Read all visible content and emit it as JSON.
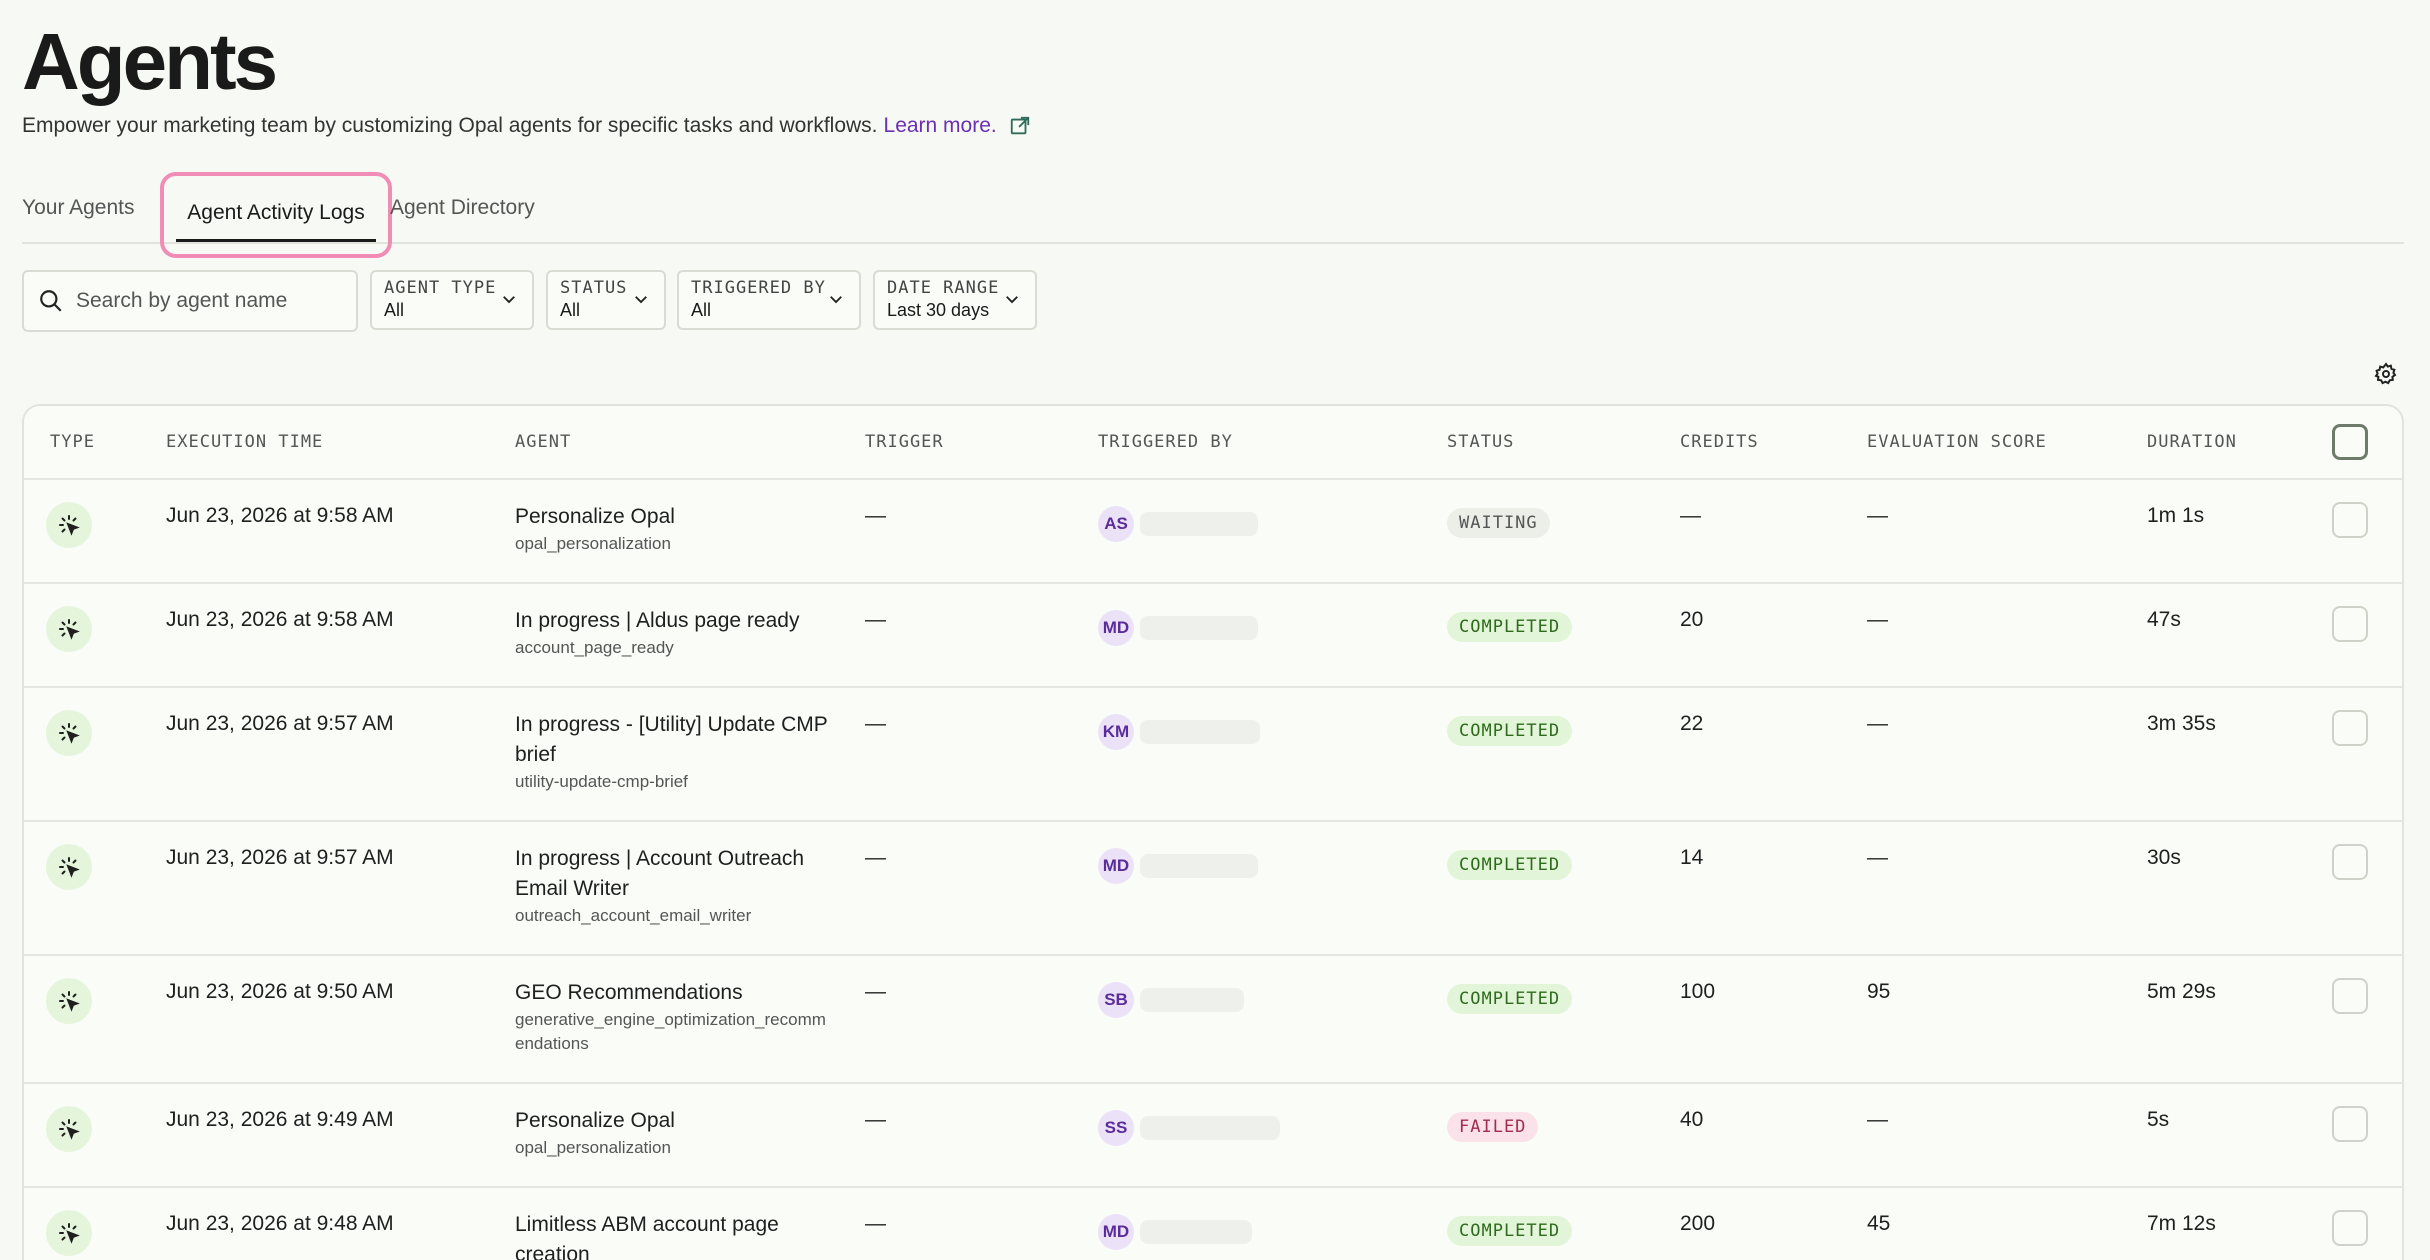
{
  "page": {
    "title": "Agents",
    "subtitle": "Empower your marketing team by customizing Opal agents for specific tasks and workflows.",
    "learn_more": "Learn more."
  },
  "tabs": [
    {
      "label": "Your Agents",
      "active": false
    },
    {
      "label": "Agent Activity Logs",
      "active": true
    },
    {
      "label": "Agent Directory",
      "active": false
    }
  ],
  "search": {
    "placeholder": "Search by agent name"
  },
  "filters": {
    "agent_type": {
      "label": "AGENT TYPE",
      "value": "All"
    },
    "status": {
      "label": "STATUS",
      "value": "All"
    },
    "triggered_by": {
      "label": "TRIGGERED BY",
      "value": "All"
    },
    "date_range": {
      "label": "DATE RANGE",
      "value": "Last 30 days"
    }
  },
  "table": {
    "headers": {
      "type": "TYPE",
      "execution_time": "EXECUTION TIME",
      "agent": "AGENT",
      "trigger": "TRIGGER",
      "triggered_by": "TRIGGERED BY",
      "status": "STATUS",
      "credits": "CREDITS",
      "evaluation_score": "EVALUATION SCORE",
      "duration": "DURATION"
    },
    "rows": [
      {
        "time": "Jun 23, 2026 at 9:58 AM",
        "agent": "Personalize Opal",
        "slug": "opal_personalization",
        "trigger": "—",
        "initials": "AS",
        "status": "WAITING",
        "credits": "—",
        "score": "—",
        "duration": "1m 1s"
      },
      {
        "time": "Jun 23, 2026 at 9:58 AM",
        "agent": "In progress | Aldus page ready",
        "slug": "account_page_ready",
        "trigger": "—",
        "initials": "MD",
        "status": "COMPLETED",
        "credits": "20",
        "score": "—",
        "duration": "47s"
      },
      {
        "time": "Jun 23, 2026 at 9:57 AM",
        "agent": "In progress - [Utility] Update CMP brief",
        "slug": "utility-update-cmp-brief",
        "trigger": "—",
        "initials": "KM",
        "status": "COMPLETED",
        "credits": "22",
        "score": "—",
        "duration": "3m 35s"
      },
      {
        "time": "Jun 23, 2026 at 9:57 AM",
        "agent": "In progress | Account Outreach Email Writer",
        "slug": "outreach_account_email_writer",
        "trigger": "—",
        "initials": "MD",
        "status": "COMPLETED",
        "credits": "14",
        "score": "—",
        "duration": "30s"
      },
      {
        "time": "Jun 23, 2026 at 9:50 AM",
        "agent": "GEO Recommendations",
        "slug": "generative_engine_optimization_recommendations",
        "trigger": "—",
        "initials": "SB",
        "status": "COMPLETED",
        "credits": "100",
        "score": "95",
        "duration": "5m 29s"
      },
      {
        "time": "Jun 23, 2026 at 9:49 AM",
        "agent": "Personalize Opal",
        "slug": "opal_personalization",
        "trigger": "—",
        "initials": "SS",
        "status": "FAILED",
        "credits": "40",
        "score": "—",
        "duration": "5s"
      },
      {
        "time": "Jun 23, 2026 at 9:48 AM",
        "agent": "Limitless ABM account page creation",
        "slug": "",
        "trigger": "—",
        "initials": "MD",
        "status": "COMPLETED",
        "credits": "200",
        "score": "45",
        "duration": "7m 12s"
      }
    ]
  },
  "icons": {
    "external_link": "external-link-icon",
    "search": "search-icon",
    "chevron": "chevron-down-icon",
    "settings": "gear-icon",
    "agent_type": "sparkle-cursor-icon"
  },
  "colors": {
    "accent_link": "#6b2fb3",
    "tab_highlight": "#f08cb5",
    "completed": "#2e6b1d",
    "failed": "#a12c52"
  }
}
